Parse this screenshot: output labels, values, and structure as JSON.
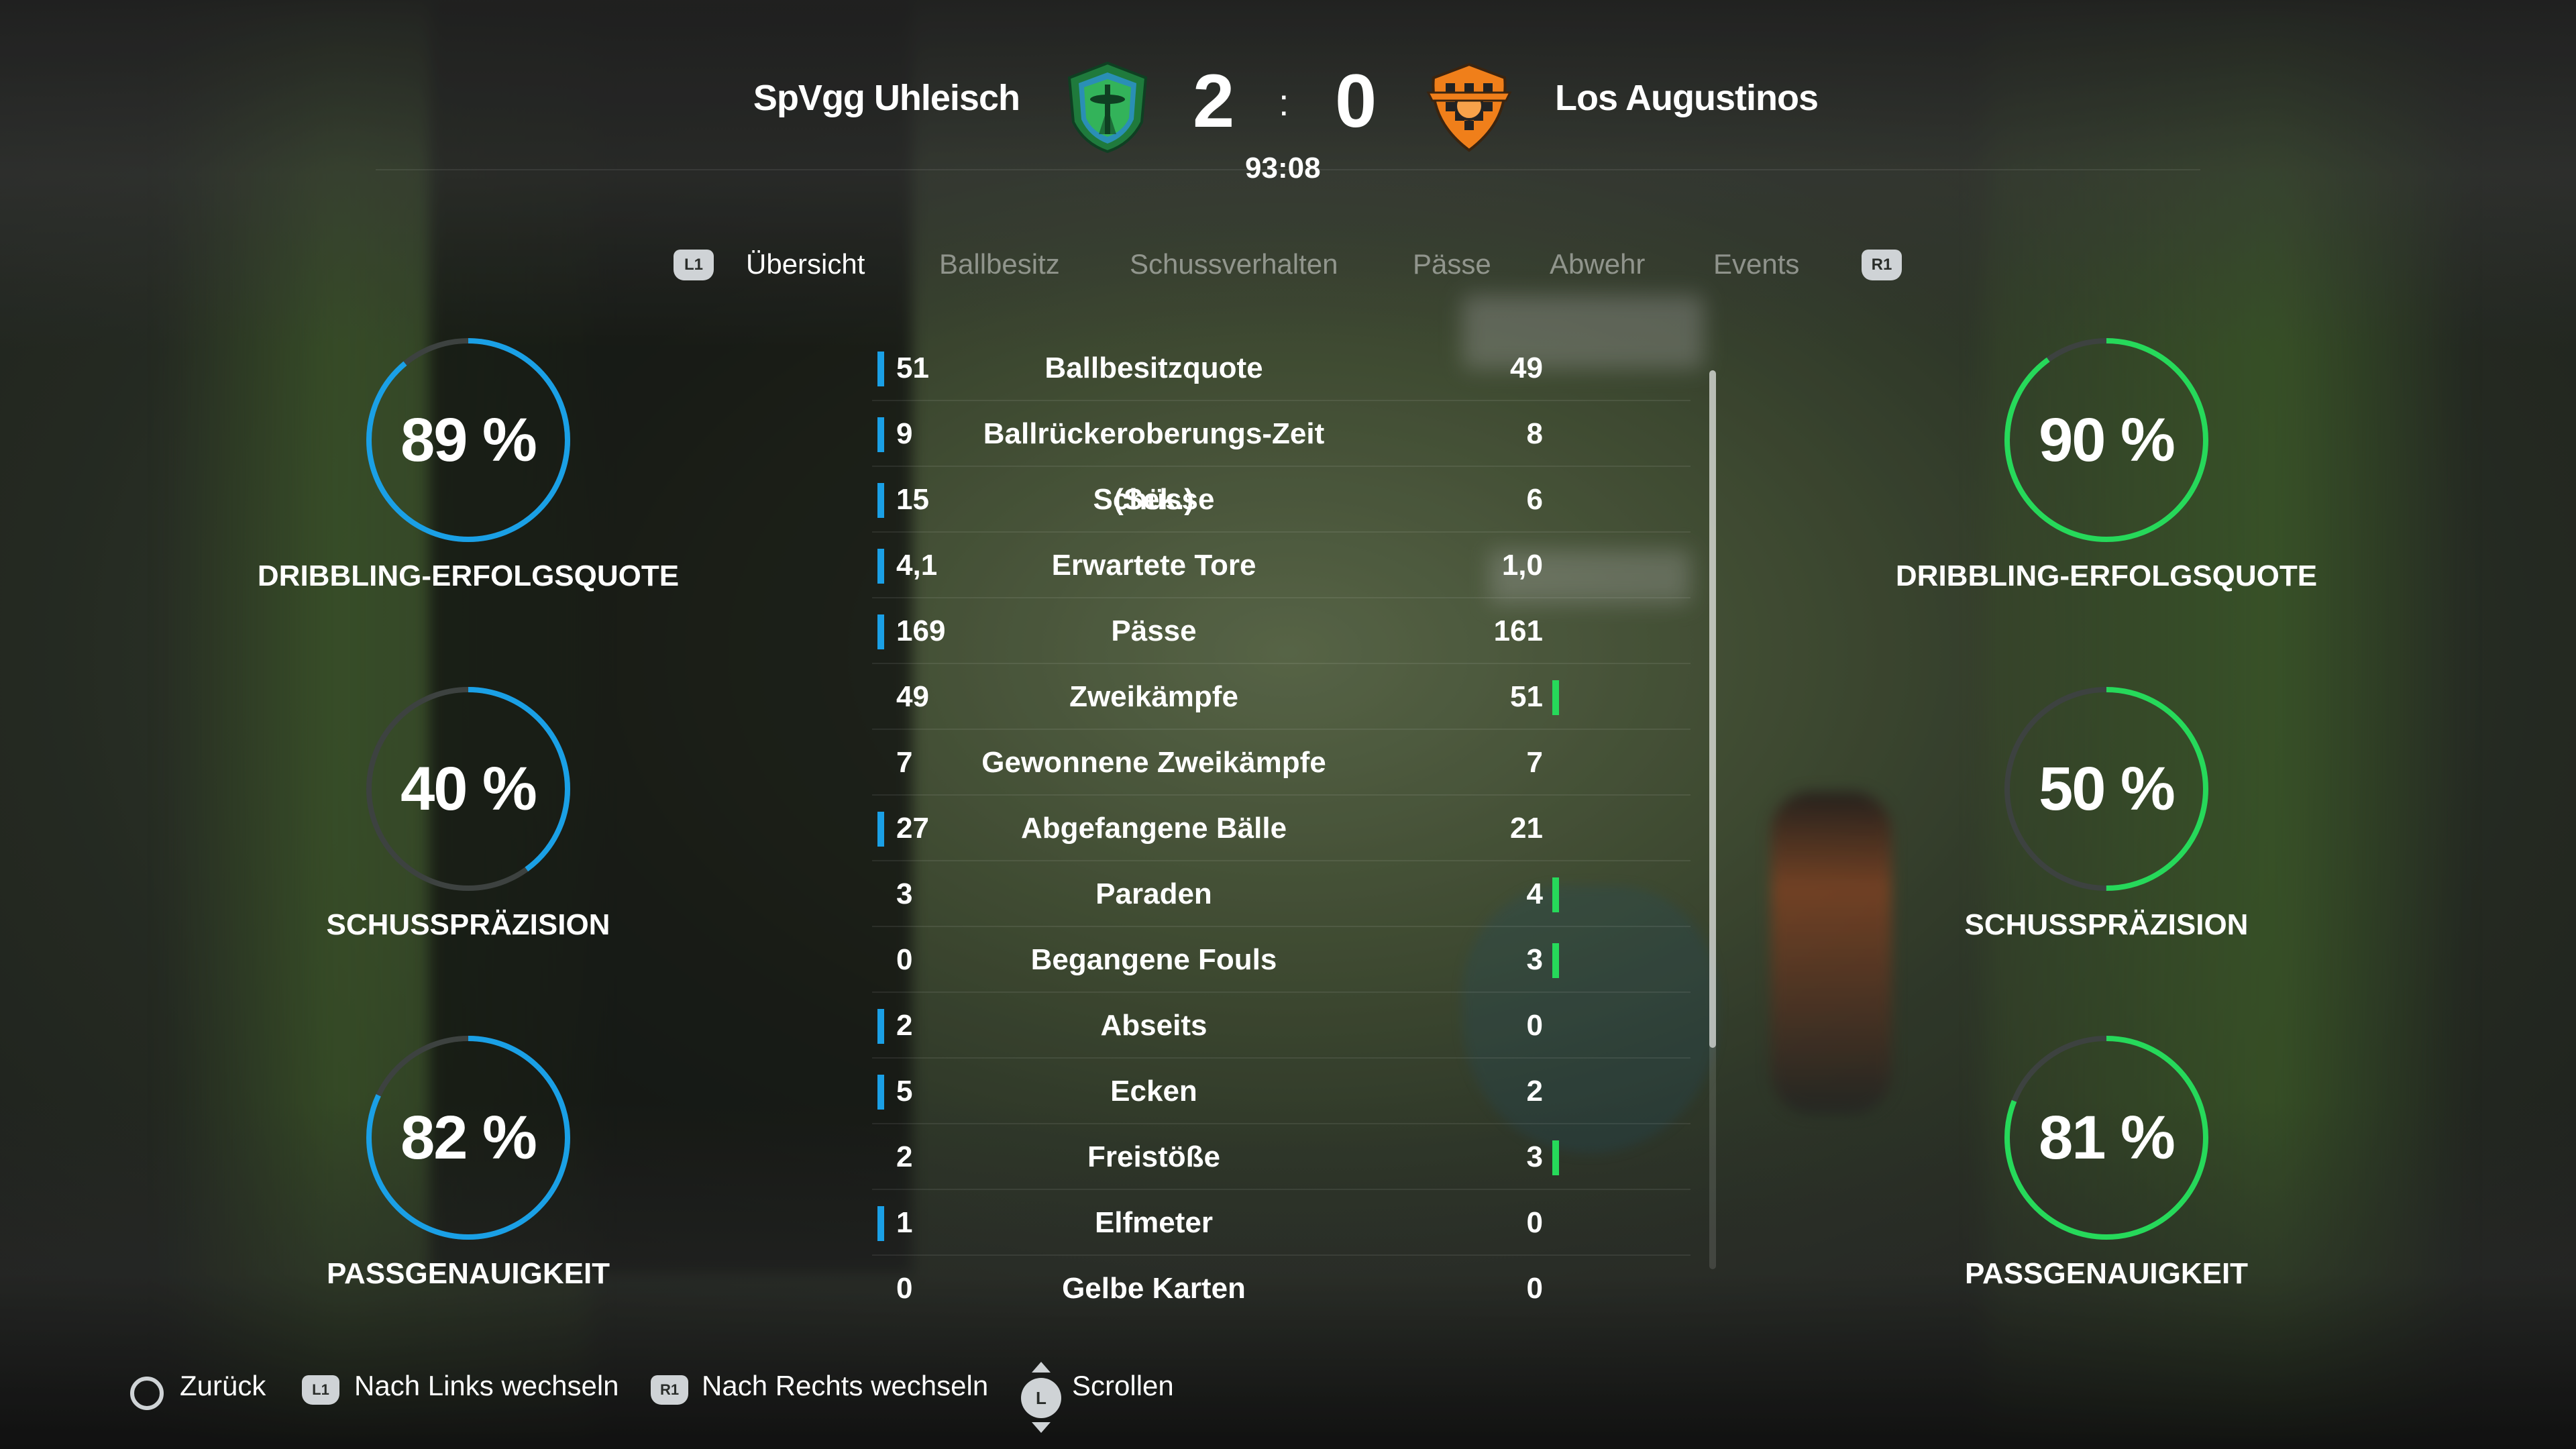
{
  "header": {
    "home_team": "SpVgg Uhleisch",
    "away_team": "Los Augustinos",
    "home_score": "2",
    "score_separator": ":",
    "away_score": "0",
    "clock": "93:08"
  },
  "tabs": {
    "left_badge": "L1",
    "right_badge": "R1",
    "items": [
      {
        "label": "Übersicht",
        "active": true
      },
      {
        "label": "Ballbesitz",
        "active": false
      },
      {
        "label": "Schussverhalten",
        "active": false
      },
      {
        "label": "Pässe",
        "active": false
      },
      {
        "label": "Abwehr",
        "active": false
      },
      {
        "label": "Events",
        "active": false
      }
    ]
  },
  "gauges": {
    "home": [
      {
        "value_text": "89 %",
        "value": 89,
        "label": "DRIBBLING-ERFOLGSQUOTE"
      },
      {
        "value_text": "40 %",
        "value": 40,
        "label": "SCHUSSPRÄZISION"
      },
      {
        "value_text": "82 %",
        "value": 82,
        "label": "PASSGENAUIGKEIT"
      }
    ],
    "away": [
      {
        "value_text": "90 %",
        "value": 90,
        "label": "DRIBBLING-ERFOLGSQUOTE"
      },
      {
        "value_text": "50 %",
        "value": 50,
        "label": "SCHUSSPRÄZISION"
      },
      {
        "value_text": "81 %",
        "value": 81,
        "label": "PASSGENAUIGKEIT"
      }
    ]
  },
  "stats": [
    {
      "name": "Ballbesitzquote",
      "home": "51",
      "away": "49",
      "lead": "home"
    },
    {
      "name": "Ballrückeroberungs-Zeit (Sek.)",
      "home": "9",
      "away": "8",
      "lead": "home"
    },
    {
      "name": "Schüsse",
      "home": "15",
      "away": "6",
      "lead": "home"
    },
    {
      "name": "Erwartete Tore",
      "home": "4,1",
      "away": "1,0",
      "lead": "home"
    },
    {
      "name": "Pässe",
      "home": "169",
      "away": "161",
      "lead": "home"
    },
    {
      "name": "Zweikämpfe",
      "home": "49",
      "away": "51",
      "lead": "away"
    },
    {
      "name": "Gewonnene Zweikämpfe",
      "home": "7",
      "away": "7",
      "lead": "none"
    },
    {
      "name": "Abgefangene Bälle",
      "home": "27",
      "away": "21",
      "lead": "home"
    },
    {
      "name": "Paraden",
      "home": "3",
      "away": "4",
      "lead": "away"
    },
    {
      "name": "Begangene Fouls",
      "home": "0",
      "away": "3",
      "lead": "away"
    },
    {
      "name": "Abseits",
      "home": "2",
      "away": "0",
      "lead": "home"
    },
    {
      "name": "Ecken",
      "home": "5",
      "away": "2",
      "lead": "home"
    },
    {
      "name": "Freistöße",
      "home": "2",
      "away": "3",
      "lead": "away"
    },
    {
      "name": "Elfmeter",
      "home": "1",
      "away": "0",
      "lead": "home"
    },
    {
      "name": "Gelbe Karten",
      "home": "0",
      "away": "0",
      "lead": "none"
    }
  ],
  "colors": {
    "home_accent": "#1aa0e6",
    "away_accent": "#26d95a",
    "gauge_track": "#3d4240"
  },
  "footer": {
    "back_label": "Zurück",
    "left_badge": "L1",
    "left_label": "Nach Links wechseln",
    "right_badge": "R1",
    "right_label": "Nach Rechts wechseln",
    "stick_badge": "L",
    "scroll_label": "Scrollen"
  }
}
